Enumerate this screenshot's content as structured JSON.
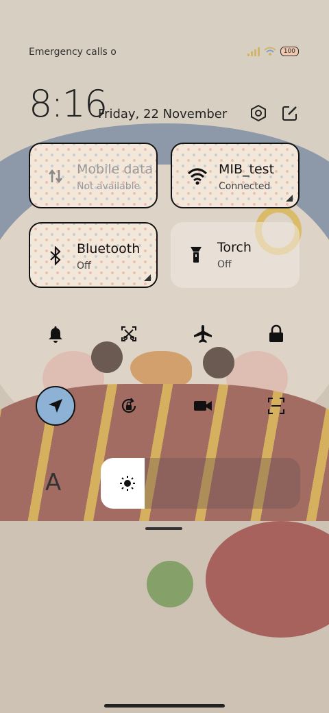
{
  "status_bar": {
    "carrier_text": "Emergency calls o",
    "battery_level": "100"
  },
  "header": {
    "time": "8:16",
    "date": "Friday, 22 November"
  },
  "tiles": {
    "mobile_data": {
      "label": "Mobile data",
      "status": "Not available",
      "active": true
    },
    "wifi": {
      "label": "MIB_test",
      "status": "Connected",
      "active": true
    },
    "bluetooth": {
      "label": "Bluetooth",
      "status": "Off",
      "active": true
    },
    "torch": {
      "label": "Torch",
      "status": "Off",
      "active": false
    }
  },
  "toggles_row1": [
    "bell-icon",
    "screenshot-icon",
    "airplane-icon",
    "lock-icon"
  ],
  "toggles_row2": [
    "location-icon",
    "rotation-lock-icon",
    "video-camera-icon",
    "scan-icon"
  ],
  "brightness": {
    "level_fraction": 0.22
  },
  "auto_font_label": "A",
  "colors": {
    "location_on": "#8db2d5",
    "tile_active_bg": "#f3e7da"
  }
}
